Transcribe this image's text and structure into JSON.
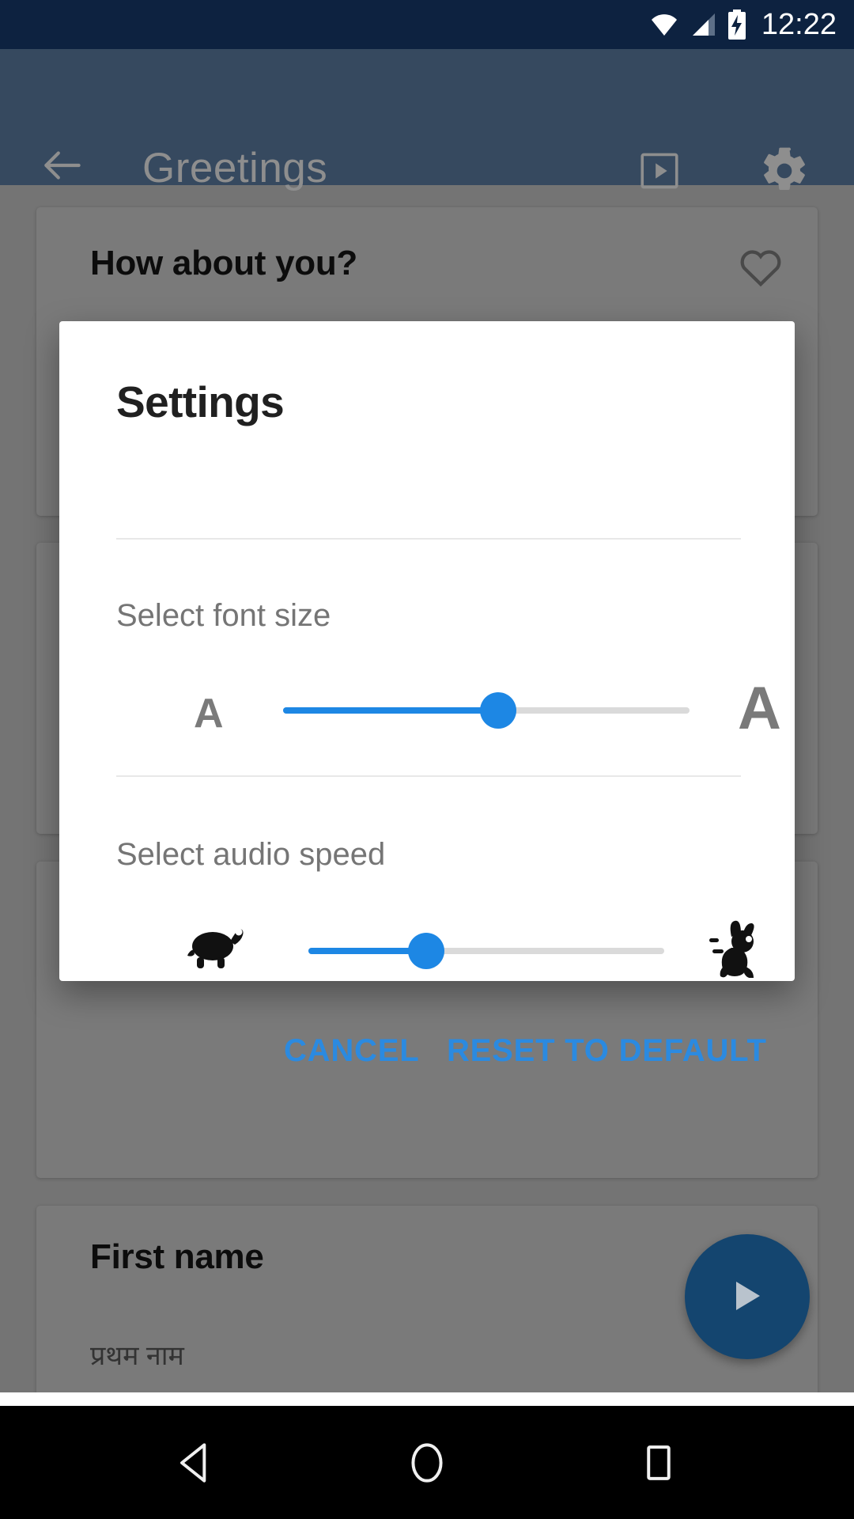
{
  "status_bar": {
    "time": "12:22",
    "icons": [
      "wifi-icon",
      "cell-signal-icon",
      "battery-charging-icon"
    ],
    "background_color": "#0d2240"
  },
  "app_bar": {
    "title": "Greetings",
    "back_label": "back-arrow-icon",
    "slideshow_label": "slideshow-play-icon",
    "settings_label": "gear-icon",
    "background_color": "#14375f",
    "title_color": "#8e8e8e"
  },
  "background_content": {
    "cards": [
      {
        "title": "How about you?",
        "subtitle": "",
        "has_favorite": true
      },
      {
        "title": "",
        "subtitle": "",
        "has_favorite": false
      },
      {
        "title": "First name",
        "subtitle": "प्रथम नाम",
        "has_favorite": true
      }
    ],
    "fab": "play-icon",
    "fab_color": "#14456f"
  },
  "dialog": {
    "title": "Settings",
    "font_size_section": {
      "label": "Select font size",
      "min_icon_label": "A",
      "max_icon_label": "A",
      "value_percent": 53,
      "accent_color": "#1d87e4",
      "track_color": "#dadada"
    },
    "audio_speed_section": {
      "label": "Select audio speed",
      "min_icon_label": "turtle-icon",
      "max_icon_label": "rabbit-icon",
      "value_percent": 33,
      "accent_color": "#1d87e4",
      "track_color": "#dadada"
    },
    "buttons": {
      "cancel": "CANCEL",
      "reset": "RESET TO DEFAULT",
      "color": "#2b8ae0"
    }
  },
  "nav_bar": {
    "back": "nav-back-icon",
    "home": "nav-home-icon",
    "recents": "nav-recents-icon",
    "background_color": "#000000"
  }
}
